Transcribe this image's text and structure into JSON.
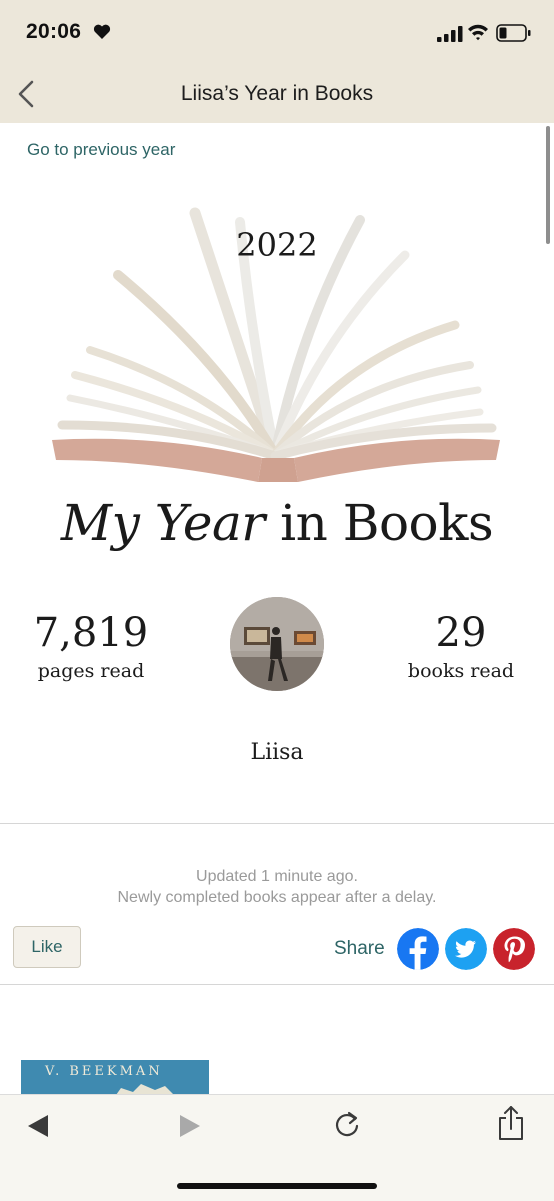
{
  "status_bar": {
    "time": "20:06"
  },
  "nav": {
    "title": "Liisa’s Year in Books"
  },
  "prev_year_link": "Go to previous year",
  "hero": {
    "year": "2022",
    "title_part1": "My Year",
    "title_part2": "in Books"
  },
  "stats": {
    "pages_value": "7,819",
    "pages_label": "pages read",
    "books_value": "29",
    "books_label": "books read"
  },
  "user": {
    "name": "Liisa"
  },
  "update_note": {
    "line1": "Updated 1 minute ago.",
    "line2": "Newly completed books appear after a delay."
  },
  "actions": {
    "like_label": "Like",
    "share_label": "Share"
  },
  "book_preview": {
    "author": "V. BEEKMAN"
  },
  "colors": {
    "header_bg": "#ece7da",
    "link_teal": "#2e6566",
    "facebook": "#1877f2",
    "twitter": "#1da1f2",
    "pinterest": "#c8232c"
  },
  "icons": [
    "heart-icon",
    "signal-icon",
    "wifi-icon",
    "battery-icon",
    "back-chevron-icon",
    "facebook-icon",
    "twitter-icon",
    "pinterest-icon",
    "browser-back-icon",
    "browser-forward-icon",
    "reload-icon",
    "share-icon"
  ]
}
